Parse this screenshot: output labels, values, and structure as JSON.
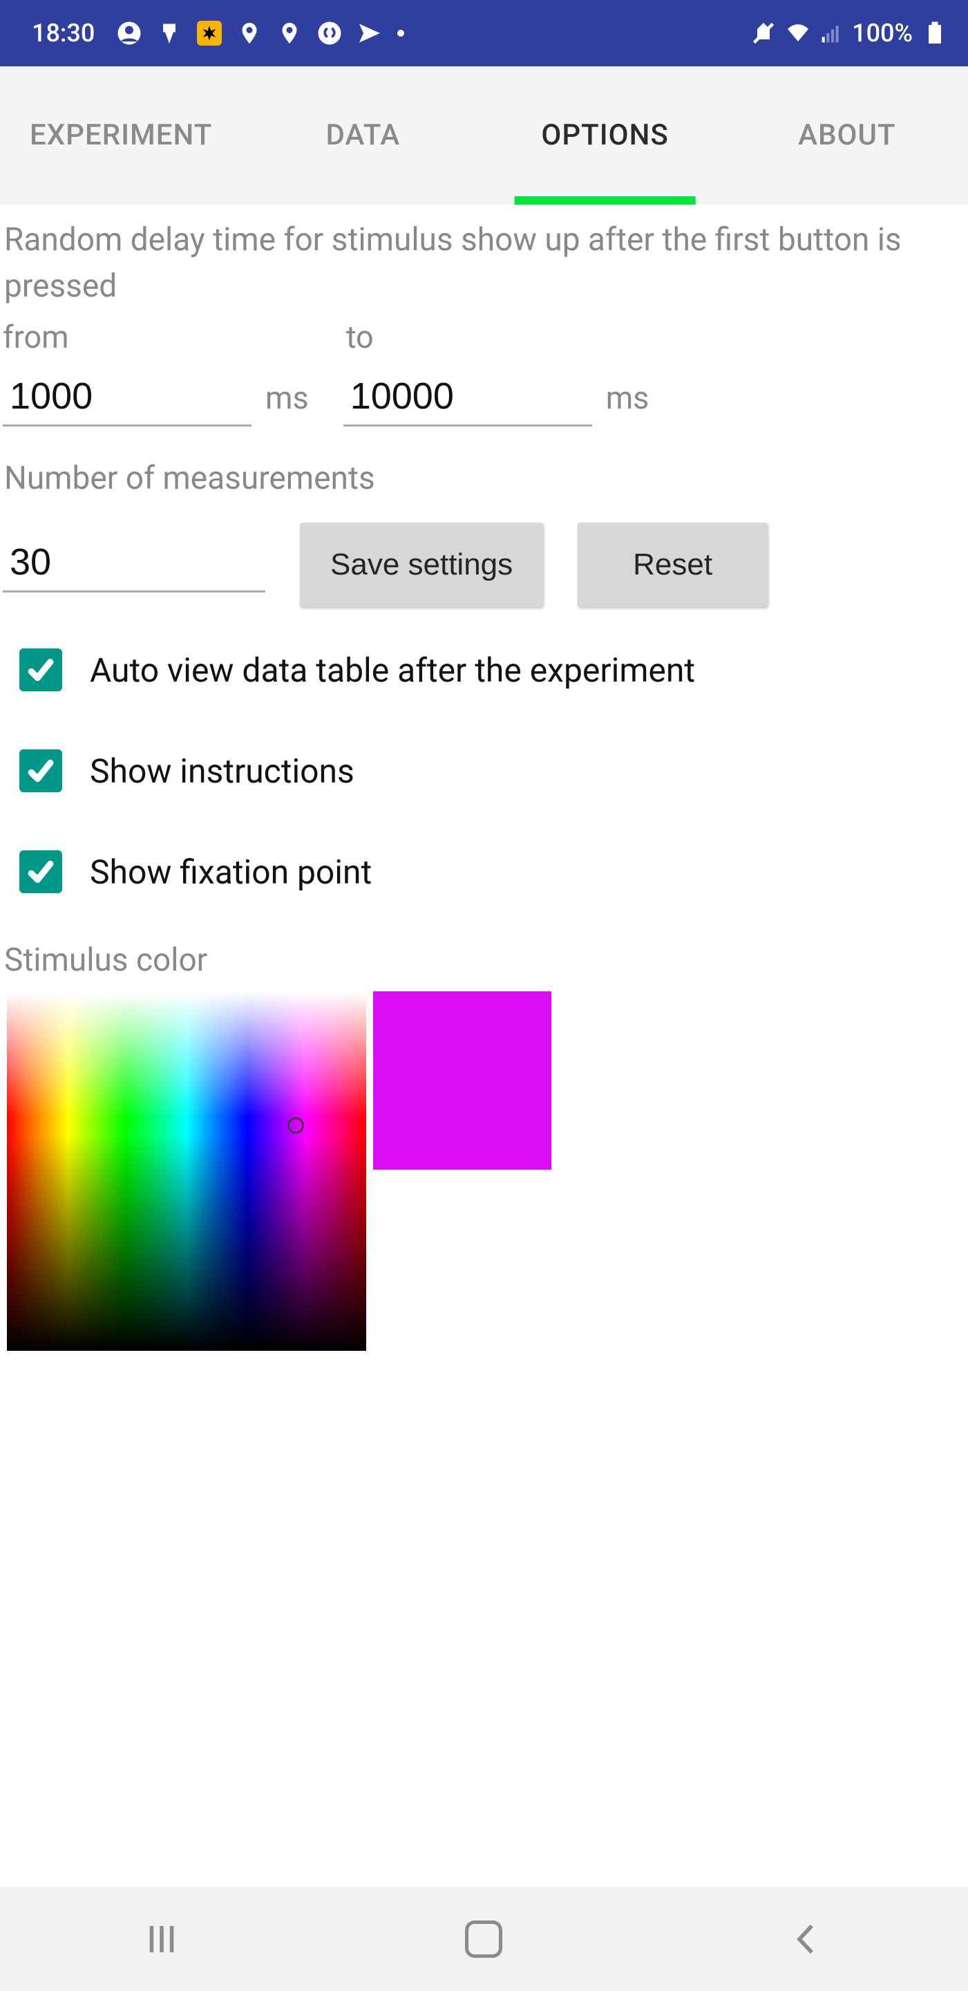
{
  "status_bar": {
    "time": "18:30",
    "battery_text": "100%"
  },
  "tabs": {
    "experiment": "EXPERIMENT",
    "data": "DATA",
    "options": "OPTIONS",
    "about": "ABOUT",
    "active": "options"
  },
  "options": {
    "delay_heading": "Random delay time for stimulus show up after the first button is pressed",
    "from_label": "from",
    "to_label": "to",
    "from_value": "1000",
    "to_value": "10000",
    "unit_ms": "ms",
    "measurements_label": "Number of measurements",
    "measurements_value": "30",
    "save_button": "Save settings",
    "reset_button": "Reset",
    "checks": {
      "auto_view": "Auto view data table after the experiment",
      "show_instructions": "Show instructions",
      "show_fixation": "Show fixation point"
    },
    "stimulus_color_label": "Stimulus color",
    "selected_color": "#de0df7"
  }
}
